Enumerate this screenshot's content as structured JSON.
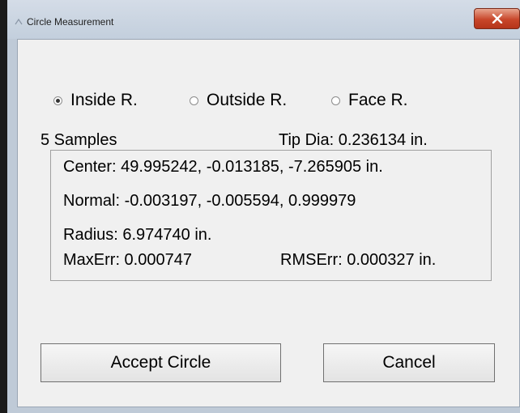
{
  "window": {
    "title": "Circle Measurement"
  },
  "mode_options": [
    {
      "label": "Inside R.",
      "selected": true
    },
    {
      "label": "Outside R.",
      "selected": false
    },
    {
      "label": "Face R.",
      "selected": false
    }
  ],
  "samples_label": "5 Samples",
  "tip_dia_label": "Tip Dia: 0.236134 in.",
  "results": {
    "center": "Center: 49.995242, -0.013185, -7.265905 in.",
    "normal": "Normal: -0.003197, -0.005594, 0.999979",
    "radius": "Radius: 6.974740 in.",
    "max_err": "MaxErr: 0.000747",
    "rms_err": "RMSErr: 0.000327 in."
  },
  "buttons": {
    "accept": "Accept Circle",
    "cancel": "Cancel"
  },
  "colors": {
    "close_button": "#c8462a",
    "dialog_bg": "#f0f0f0",
    "frame": "#bfcad7"
  },
  "icons": {
    "close": "close-icon",
    "app": "app-icon"
  }
}
